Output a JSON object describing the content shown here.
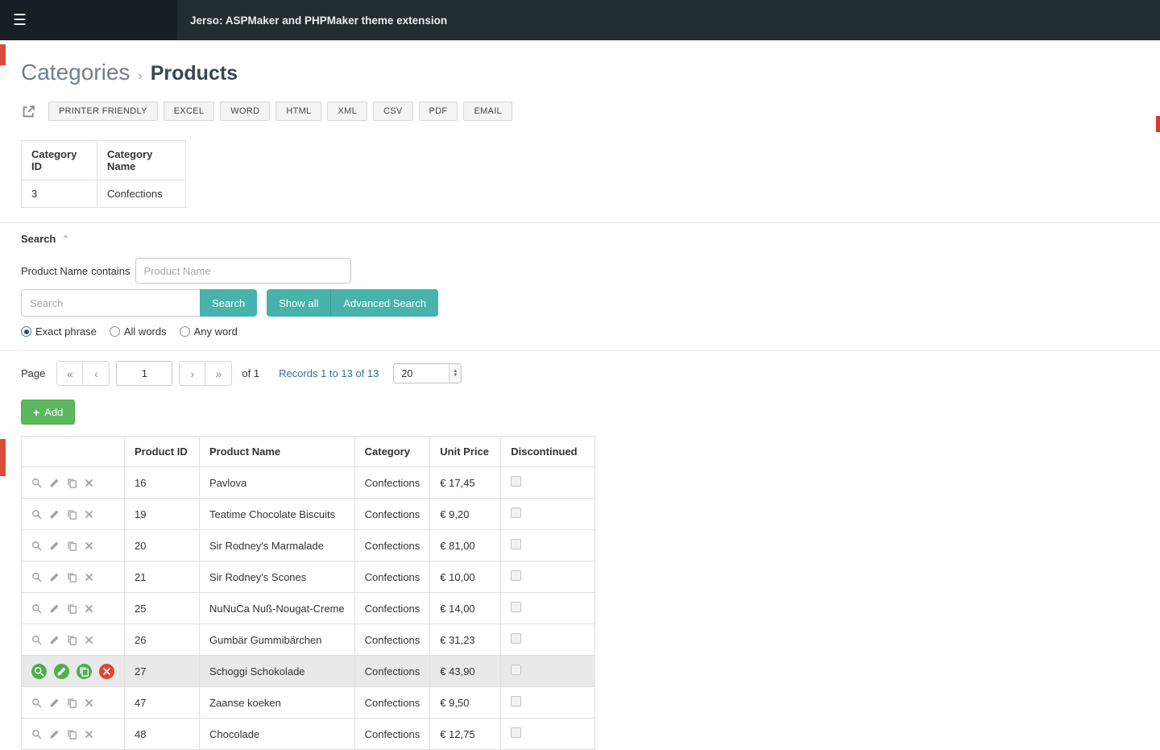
{
  "colors": {
    "teal": "#47b3aa",
    "green": "#5cb85c",
    "icon_green": "#4caf50",
    "icon_red": "#e0442f",
    "dark_left": "#171f24",
    "dark_main": "#222d32",
    "accent_orange": "#dd4b39",
    "highlight": "#e9e9e9"
  },
  "topbar": {
    "title": "Jerso: ASPMaker and PHPMaker theme extension"
  },
  "breadcrumb": {
    "parent": "Categories",
    "separator": "›",
    "current": "Products"
  },
  "toolbar": {
    "buttons": [
      "PRINTER FRIENDLY",
      "EXCEL",
      "WORD",
      "HTML",
      "XML",
      "CSV",
      "PDF",
      "EMAIL"
    ]
  },
  "master": {
    "headers": [
      "Category ID",
      "Category Name"
    ],
    "values": [
      "3",
      "Confections"
    ]
  },
  "search": {
    "title": "Search",
    "field_label": "Product Name",
    "operator": "contains",
    "name_placeholder": "Product Name",
    "basic_placeholder": "Search",
    "search_button": "Search",
    "show_all_button": "Show all",
    "advanced_button": "Advanced Search",
    "radios": [
      {
        "label": "Exact phrase",
        "checked": true
      },
      {
        "label": "All words",
        "checked": false
      },
      {
        "label": "Any word",
        "checked": false
      }
    ]
  },
  "pager": {
    "page_label": "Page",
    "first": "«",
    "prev": "‹",
    "next": "›",
    "last": "»",
    "current": "1",
    "of_label": "of 1",
    "records": "Records 1 to 13 of 13",
    "page_size": "20"
  },
  "actions": {
    "add_icon": "+",
    "add_label": "Add"
  },
  "table": {
    "headers": [
      "",
      "Product ID",
      "Product Name",
      "Category",
      "Unit Price",
      "Discontinued"
    ],
    "row_actions": [
      "view",
      "edit",
      "copy",
      "delete"
    ],
    "rows": [
      {
        "id": "16",
        "name": "Pavlova",
        "category": "Confections",
        "price": "€ 17,45",
        "discontinued": false,
        "highlighted": false
      },
      {
        "id": "19",
        "name": "Teatime Chocolate Biscuits",
        "category": "Confections",
        "price": "€ 9,20",
        "discontinued": false,
        "highlighted": false
      },
      {
        "id": "20",
        "name": "Sir Rodney's Marmalade",
        "category": "Confections",
        "price": "€ 81,00",
        "discontinued": false,
        "highlighted": false
      },
      {
        "id": "21",
        "name": "Sir Rodney's Scones",
        "category": "Confections",
        "price": "€ 10,00",
        "discontinued": false,
        "highlighted": false
      },
      {
        "id": "25",
        "name": "NuNuCa Nuß-Nougat-Creme",
        "category": "Confections",
        "price": "€ 14,00",
        "discontinued": false,
        "highlighted": false
      },
      {
        "id": "26",
        "name": "Gumbär Gummibärchen",
        "category": "Confections",
        "price": "€ 31,23",
        "discontinued": false,
        "highlighted": false
      },
      {
        "id": "27",
        "name": "Schoggi Schokolade",
        "category": "Confections",
        "price": "€ 43,90",
        "discontinued": false,
        "highlighted": true
      },
      {
        "id": "47",
        "name": "Zaanse koeken",
        "category": "Confections",
        "price": "€ 9,50",
        "discontinued": false,
        "highlighted": false
      },
      {
        "id": "48",
        "name": "Chocolade",
        "category": "Confections",
        "price": "€ 12,75",
        "discontinued": false,
        "highlighted": false
      }
    ]
  }
}
